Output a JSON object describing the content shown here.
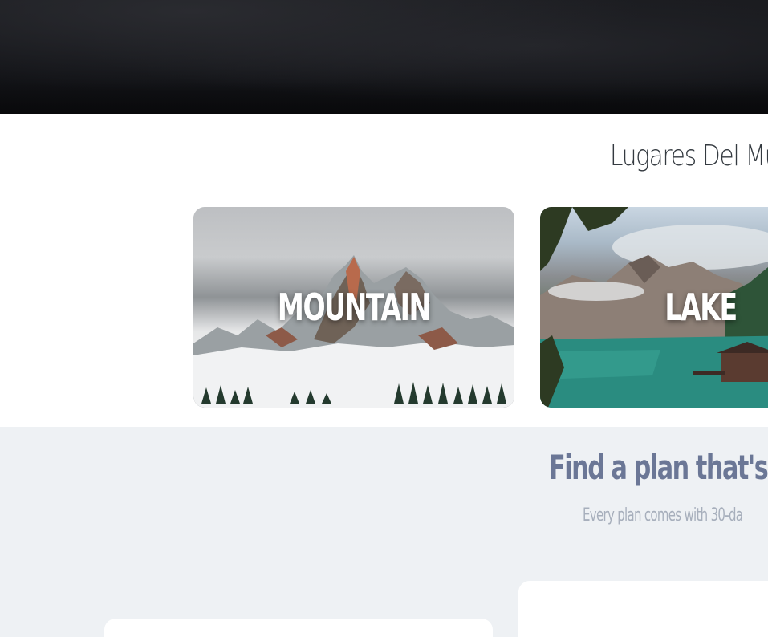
{
  "places": {
    "title": "Lugares Del Mu",
    "cards": [
      {
        "label": "MOUNTAIN"
      },
      {
        "label": "LAKE"
      }
    ]
  },
  "pricing": {
    "title": "Find a plan that's rig",
    "subtitle": "Every plan comes with 30-da"
  }
}
